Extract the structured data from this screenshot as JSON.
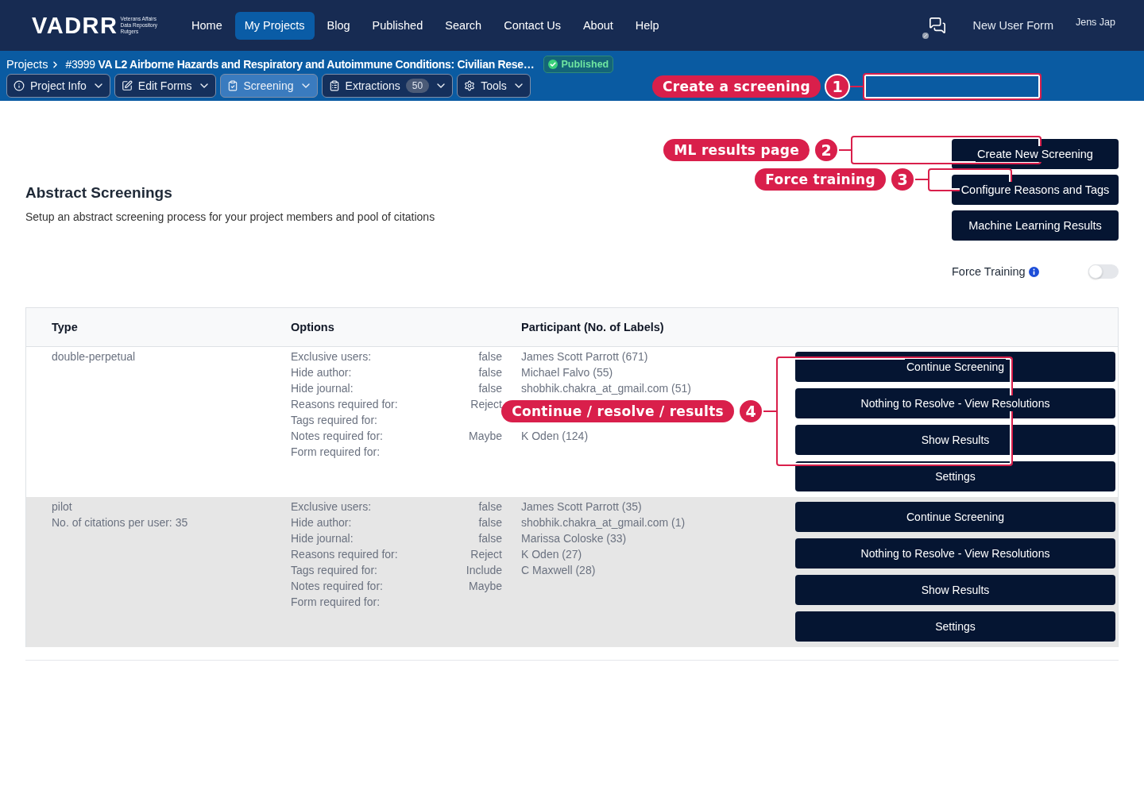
{
  "header": {
    "logo": {
      "wordmark": "VADRR",
      "tagline": [
        "Veterans Affairs",
        "Data Repository",
        "Rutgers"
      ]
    },
    "nav": [
      {
        "label": "Home",
        "selected": false
      },
      {
        "label": "My Projects",
        "selected": true
      },
      {
        "label": "Blog",
        "selected": false
      },
      {
        "label": "Published",
        "selected": false
      },
      {
        "label": "Search",
        "selected": false
      },
      {
        "label": "Contact Us",
        "selected": false
      },
      {
        "label": "About",
        "selected": false
      },
      {
        "label": "Help",
        "selected": false
      }
    ],
    "new_user_form": "New User Form",
    "user": "Jens Jap"
  },
  "project_bar": {
    "breadcrumb": {
      "root": "Projects",
      "title": "#3999 **VA L2 Airborne Hazards and Respiratory and Autoimmune Conditions: Civilian Rese…**"
    },
    "status_badge": "Published",
    "tabs": [
      {
        "label": "Project Info",
        "selected": false
      },
      {
        "label": "Edit Forms",
        "selected": false
      },
      {
        "label": "Screening",
        "selected": true
      },
      {
        "label": "Extractions",
        "selected": false,
        "count": "50"
      },
      {
        "label": "Tools",
        "selected": false
      }
    ]
  },
  "screenings": {
    "title": "Abstract Screenings",
    "description": "Setup an abstract screening process for your project members and pool of citations",
    "actions": [
      "Create New Screening",
      "Configure Reasons and Tags",
      "Machine Learning Results"
    ],
    "force_training": {
      "label": "Force Training",
      "on": false
    },
    "table": {
      "columns": [
        "Type",
        "Options",
        "Participant (No. of Labels)"
      ],
      "rows": [
        {
          "type": [
            "double-perpetual"
          ],
          "options": [
            {
              "label": "Exclusive users:",
              "value": "false"
            },
            {
              "label": "Hide author:",
              "value": "false"
            },
            {
              "label": "Hide journal:",
              "value": "false"
            },
            {
              "label": "Reasons required for:",
              "value": "Reject"
            },
            {
              "label": "Tags required for:"
            },
            {
              "label": "Notes required for:",
              "value": "Maybe"
            },
            {
              "label": "Form required for:"
            }
          ],
          "participants": [
            "James Scott Parrott (671)",
            "Michael Falvo (55)",
            "shobhik.chakra_at_gmail.com (51)"
          ],
          "participants_below_callout": [
            "K Oden (124)"
          ],
          "actions": [
            "Continue Screening",
            "Nothing to Resolve - View Resolutions",
            "Show Results",
            "Settings"
          ]
        },
        {
          "type": [
            "pilot",
            "No. of citations per user: 35"
          ],
          "options": [
            {
              "label": "Exclusive users:",
              "value": "false"
            },
            {
              "label": "Hide author:",
              "value": "false"
            },
            {
              "label": "Hide journal:",
              "value": "false"
            },
            {
              "label": "Reasons required for:",
              "value": "Reject"
            },
            {
              "label": "Tags required for:",
              "value": "Include"
            },
            {
              "label": "Notes required for:",
              "value": "Maybe"
            },
            {
              "label": "Form required for:"
            }
          ],
          "participants": [
            "James Scott Parrott (35)",
            "shobhik.chakra_at_gmail.com (1)",
            "Marissa Coloske (33)",
            "K Oden (27)",
            "C Maxwell (28)"
          ],
          "actions": [
            "Continue Screening",
            "Nothing to Resolve - View Resolutions",
            "Show Results",
            "Settings"
          ]
        }
      ]
    }
  },
  "annotations": [
    {
      "number": "1",
      "label": "Create a screening"
    },
    {
      "number": "2",
      "label": "ML results page"
    },
    {
      "number": "3",
      "label": "Force training"
    },
    {
      "number": "4",
      "label": "Continue / resolve / results"
    }
  ]
}
